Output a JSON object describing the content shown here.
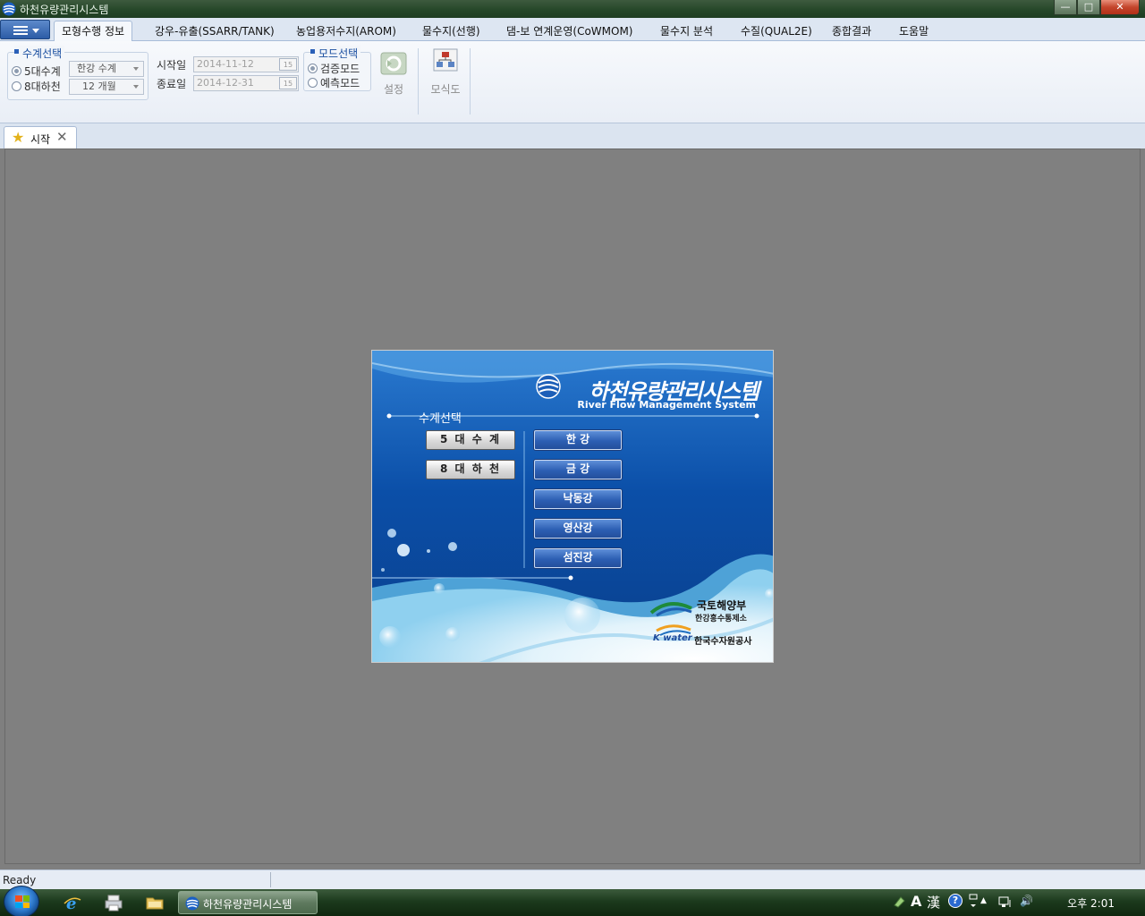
{
  "window": {
    "title": "하천유량관리시스템",
    "minimize_glyph": "—",
    "maximize_glyph": "□",
    "close_glyph": "✕"
  },
  "ribbon_tabs": [
    {
      "label": "모형수행 정보"
    },
    {
      "label": "강우-유출(SSARR/TANK)"
    },
    {
      "label": "농업용저수지(AROM)"
    },
    {
      "label": "물수지(선행)"
    },
    {
      "label": "댐-보 연계운영(CoWMOM)"
    },
    {
      "label": "물수지 분석"
    },
    {
      "label": "수질(QUAL2E)"
    },
    {
      "label": "종합결과"
    },
    {
      "label": "도움말"
    }
  ],
  "ribbon": {
    "basin_group": {
      "title": "수계선택",
      "radio_5": "5대수계",
      "radio_8": "8대하천",
      "combo_5": "한강 수계",
      "combo_8": "12 개월"
    },
    "dates": {
      "start_label": "시작일",
      "start_value": "2014-11-12",
      "end_label": "종료일",
      "end_value": "2014-12-31",
      "cal_glyph": "15"
    },
    "mode_group": {
      "title": "모드선택",
      "radio_verify": "검증모드",
      "radio_predict": "예측모드"
    },
    "settings_label": "설정",
    "schematic_label": "모식도"
  },
  "doc_tab": {
    "label": "시작",
    "close_glyph": "✕",
    "star_glyph": "★"
  },
  "splash": {
    "title": "하천유량관리시스템",
    "subtitle": "River Flow Management System",
    "section_title": "수계선택",
    "btn_5": "5 대 수 계",
    "btn_8": "8 대 하 천",
    "rivers": [
      "한   강",
      "금   강",
      "낙동강",
      "영산강",
      "섬진강"
    ],
    "org1": "국토해양부",
    "org1_sub": "한강홍수통제소",
    "kwater": "K water",
    "org2": "한국수자원공사"
  },
  "statusbar": {
    "text": "Ready"
  },
  "taskbar": {
    "app_label": "하천유량관리시스템",
    "tray_ime": "A",
    "tray_hanja": "漢",
    "tray_help": "?",
    "tray_arrow": "▲",
    "tray_volume": "🔊",
    "clock": "오후 2:01"
  },
  "colors": {
    "splash_blue": "#0b4fa8",
    "accent_title": "#1a4fa0",
    "taskbar": "#1c3a1d"
  }
}
